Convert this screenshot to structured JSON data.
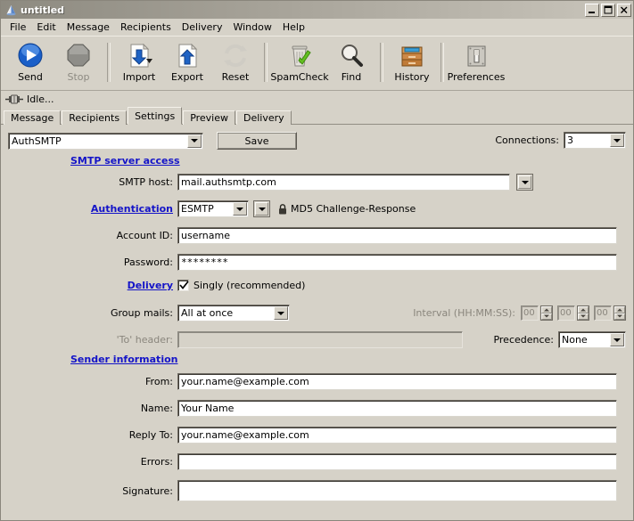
{
  "window": {
    "title": "untitled",
    "app_icon": "cone-icon",
    "controls": {
      "minimize": "minimize-icon",
      "maximize": "maximize-icon",
      "close": "close-icon"
    }
  },
  "menubar": {
    "items": [
      "File",
      "Edit",
      "Message",
      "Recipients",
      "Delivery",
      "Window",
      "Help"
    ]
  },
  "toolbar": {
    "buttons": [
      {
        "label": "Send",
        "icon": "play-circle-icon",
        "enabled": true,
        "has_caret": false
      },
      {
        "label": "Stop",
        "icon": "stop-octagon-icon",
        "enabled": false,
        "has_caret": false
      },
      {
        "label": "Import",
        "icon": "document-down-arrow-icon",
        "enabled": true,
        "has_caret": true
      },
      {
        "label": "Export",
        "icon": "document-up-arrow-icon",
        "enabled": true,
        "has_caret": false
      },
      {
        "label": "Reset",
        "icon": "refresh-arrows-icon",
        "enabled": true,
        "has_caret": false
      },
      {
        "label": "SpamCheck",
        "icon": "trash-check-icon",
        "enabled": true,
        "has_caret": false
      },
      {
        "label": "Find",
        "icon": "magnifier-icon",
        "enabled": true,
        "has_caret": false
      },
      {
        "label": "History",
        "icon": "file-cabinet-icon",
        "enabled": true,
        "has_caret": false
      },
      {
        "label": "Preferences",
        "icon": "switch-panel-icon",
        "enabled": true,
        "has_caret": false
      }
    ]
  },
  "status": {
    "icon": "connector-plug-icon",
    "text": "Idle..."
  },
  "tabs": {
    "items": [
      "Message",
      "Recipients",
      "Settings",
      "Preview",
      "Delivery"
    ],
    "active": "Settings"
  },
  "settings": {
    "profile": {
      "value": "AuthSMTP",
      "label_name": "profile-combo"
    },
    "save_button": "Save",
    "connections": {
      "label": "Connections:",
      "value": "3"
    },
    "sections": {
      "smtp": "SMTP server access",
      "authentication": "Authentication",
      "delivery": "Delivery",
      "sender": "Sender information"
    },
    "smtp_host": {
      "label": "SMTP host:",
      "value": "mail.authsmtp.com"
    },
    "auth_method": {
      "value": "ESMTP"
    },
    "auth_security": {
      "icon": "lock-icon",
      "text": "MD5 Challenge-Response"
    },
    "account_id": {
      "label": "Account ID:",
      "value": "username"
    },
    "password": {
      "label": "Password:",
      "value": "********"
    },
    "singly": {
      "label": "Singly (recommended)",
      "checked": true
    },
    "group_mails": {
      "label": "Group mails:",
      "value": "All at once"
    },
    "interval": {
      "label": "Interval (HH:MM:SS):",
      "hours": "00",
      "minutes": "00",
      "seconds": "00",
      "enabled": false
    },
    "to_header": {
      "label": "'To' header:",
      "value": "",
      "enabled": false
    },
    "precedence": {
      "label": "Precedence:",
      "value": "None"
    },
    "from": {
      "label": "From:",
      "value": "your.name@example.com"
    },
    "name": {
      "label": "Name:",
      "value": "Your Name"
    },
    "reply_to": {
      "label": "Reply To:",
      "value": "your.name@example.com"
    },
    "errors": {
      "label": "Errors:",
      "value": ""
    },
    "signature": {
      "label": "Signature:",
      "value": ""
    }
  },
  "colors": {
    "face": "#d6d2c8",
    "link": "#1414c8",
    "title_gradient_start": "#8d8a80",
    "title_gradient_end": "#c9c5bb",
    "disabled_text": "#8a867d"
  }
}
